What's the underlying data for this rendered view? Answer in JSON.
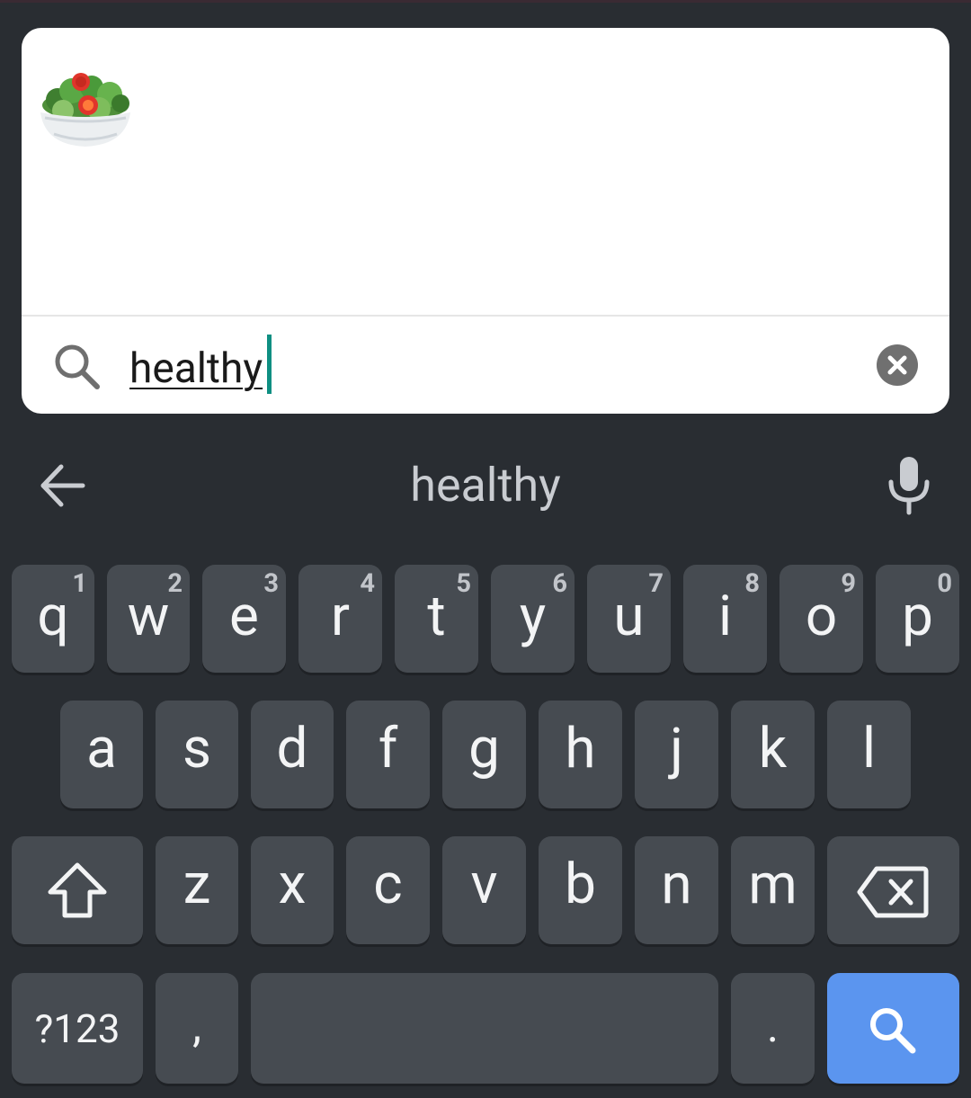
{
  "emoji_results": [
    {
      "name": "green-salad-emoji"
    }
  ],
  "search": {
    "value": "healthy",
    "icon": "search-icon",
    "clear_icon": "close-icon"
  },
  "suggestion_bar": {
    "back_icon": "arrow-left-icon",
    "suggestion": "healthy",
    "mic_icon": "microphone-icon"
  },
  "keyboard": {
    "row1": [
      {
        "key": "q",
        "hint": "1"
      },
      {
        "key": "w",
        "hint": "2"
      },
      {
        "key": "e",
        "hint": "3"
      },
      {
        "key": "r",
        "hint": "4"
      },
      {
        "key": "t",
        "hint": "5"
      },
      {
        "key": "y",
        "hint": "6"
      },
      {
        "key": "u",
        "hint": "7"
      },
      {
        "key": "i",
        "hint": "8"
      },
      {
        "key": "o",
        "hint": "9"
      },
      {
        "key": "p",
        "hint": "0"
      }
    ],
    "row2": [
      "a",
      "s",
      "d",
      "f",
      "g",
      "h",
      "j",
      "k",
      "l"
    ],
    "row3": [
      "z",
      "x",
      "c",
      "v",
      "b",
      "n",
      "m"
    ],
    "shift_icon": "shift-icon",
    "backspace_icon": "backspace-icon",
    "symbols": "?123",
    "comma": ",",
    "period": ".",
    "enter_icon": "search-icon",
    "colors": {
      "background": "#292d32",
      "key": "#464b51",
      "enter": "#5b95ef",
      "accent_caret": "#0f8f82"
    }
  }
}
